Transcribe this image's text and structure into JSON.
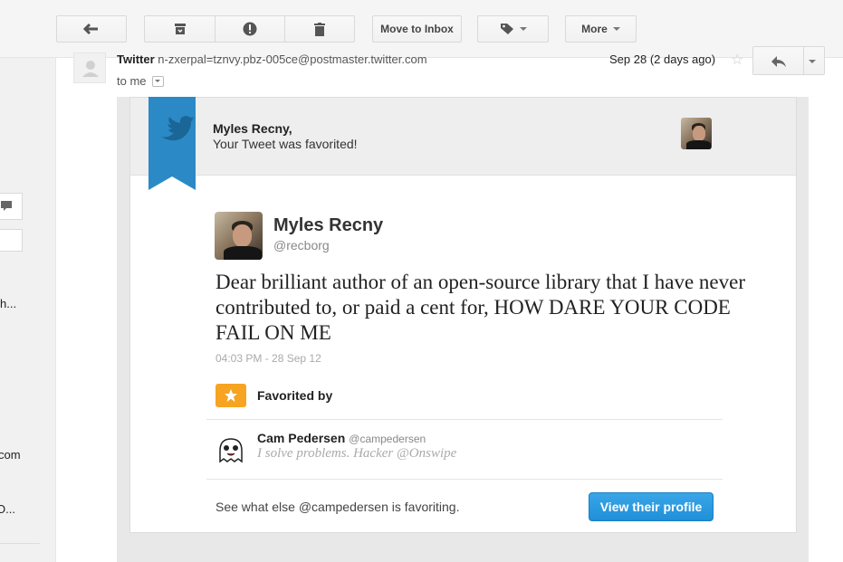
{
  "toolbar": {
    "move_to_inbox": "Move to Inbox",
    "more": "More"
  },
  "sidebar": {
    "snippet_1": "h...",
    "snippet_2": "com",
    "snippet_3": "O..."
  },
  "message": {
    "sender_name": "Twitter",
    "sender_address": "n-zxerpal=tznvy.pbz-005ce@postmaster.twitter.com",
    "to_me": "to me",
    "date": "Sep 28 (2 days ago)"
  },
  "email": {
    "greeting_name": "Myles Recny,",
    "greeting_msg": "Your Tweet was favorited!",
    "tweet": {
      "author_name": "Myles Recny",
      "author_handle": "@recborg",
      "text": "Dear brilliant author of an open-source library that I have never contributed to, or paid a cent for, HOW DARE YOUR CODE FAIL ON ME",
      "timestamp": "04:03 PM - 28 Sep 12"
    },
    "favorited_by_label": "Favorited by",
    "favoriter": {
      "name": "Cam Pedersen",
      "handle": "@campedersen",
      "bio": "I solve problems. Hacker @Onswipe"
    },
    "see_what": "See what else @campedersen is favoriting.",
    "view_profile": "View their profile"
  },
  "colors": {
    "twitter_blue": "#2b8ac6",
    "fav_orange": "#f6a422",
    "button_blue": "#1f8fd8"
  }
}
